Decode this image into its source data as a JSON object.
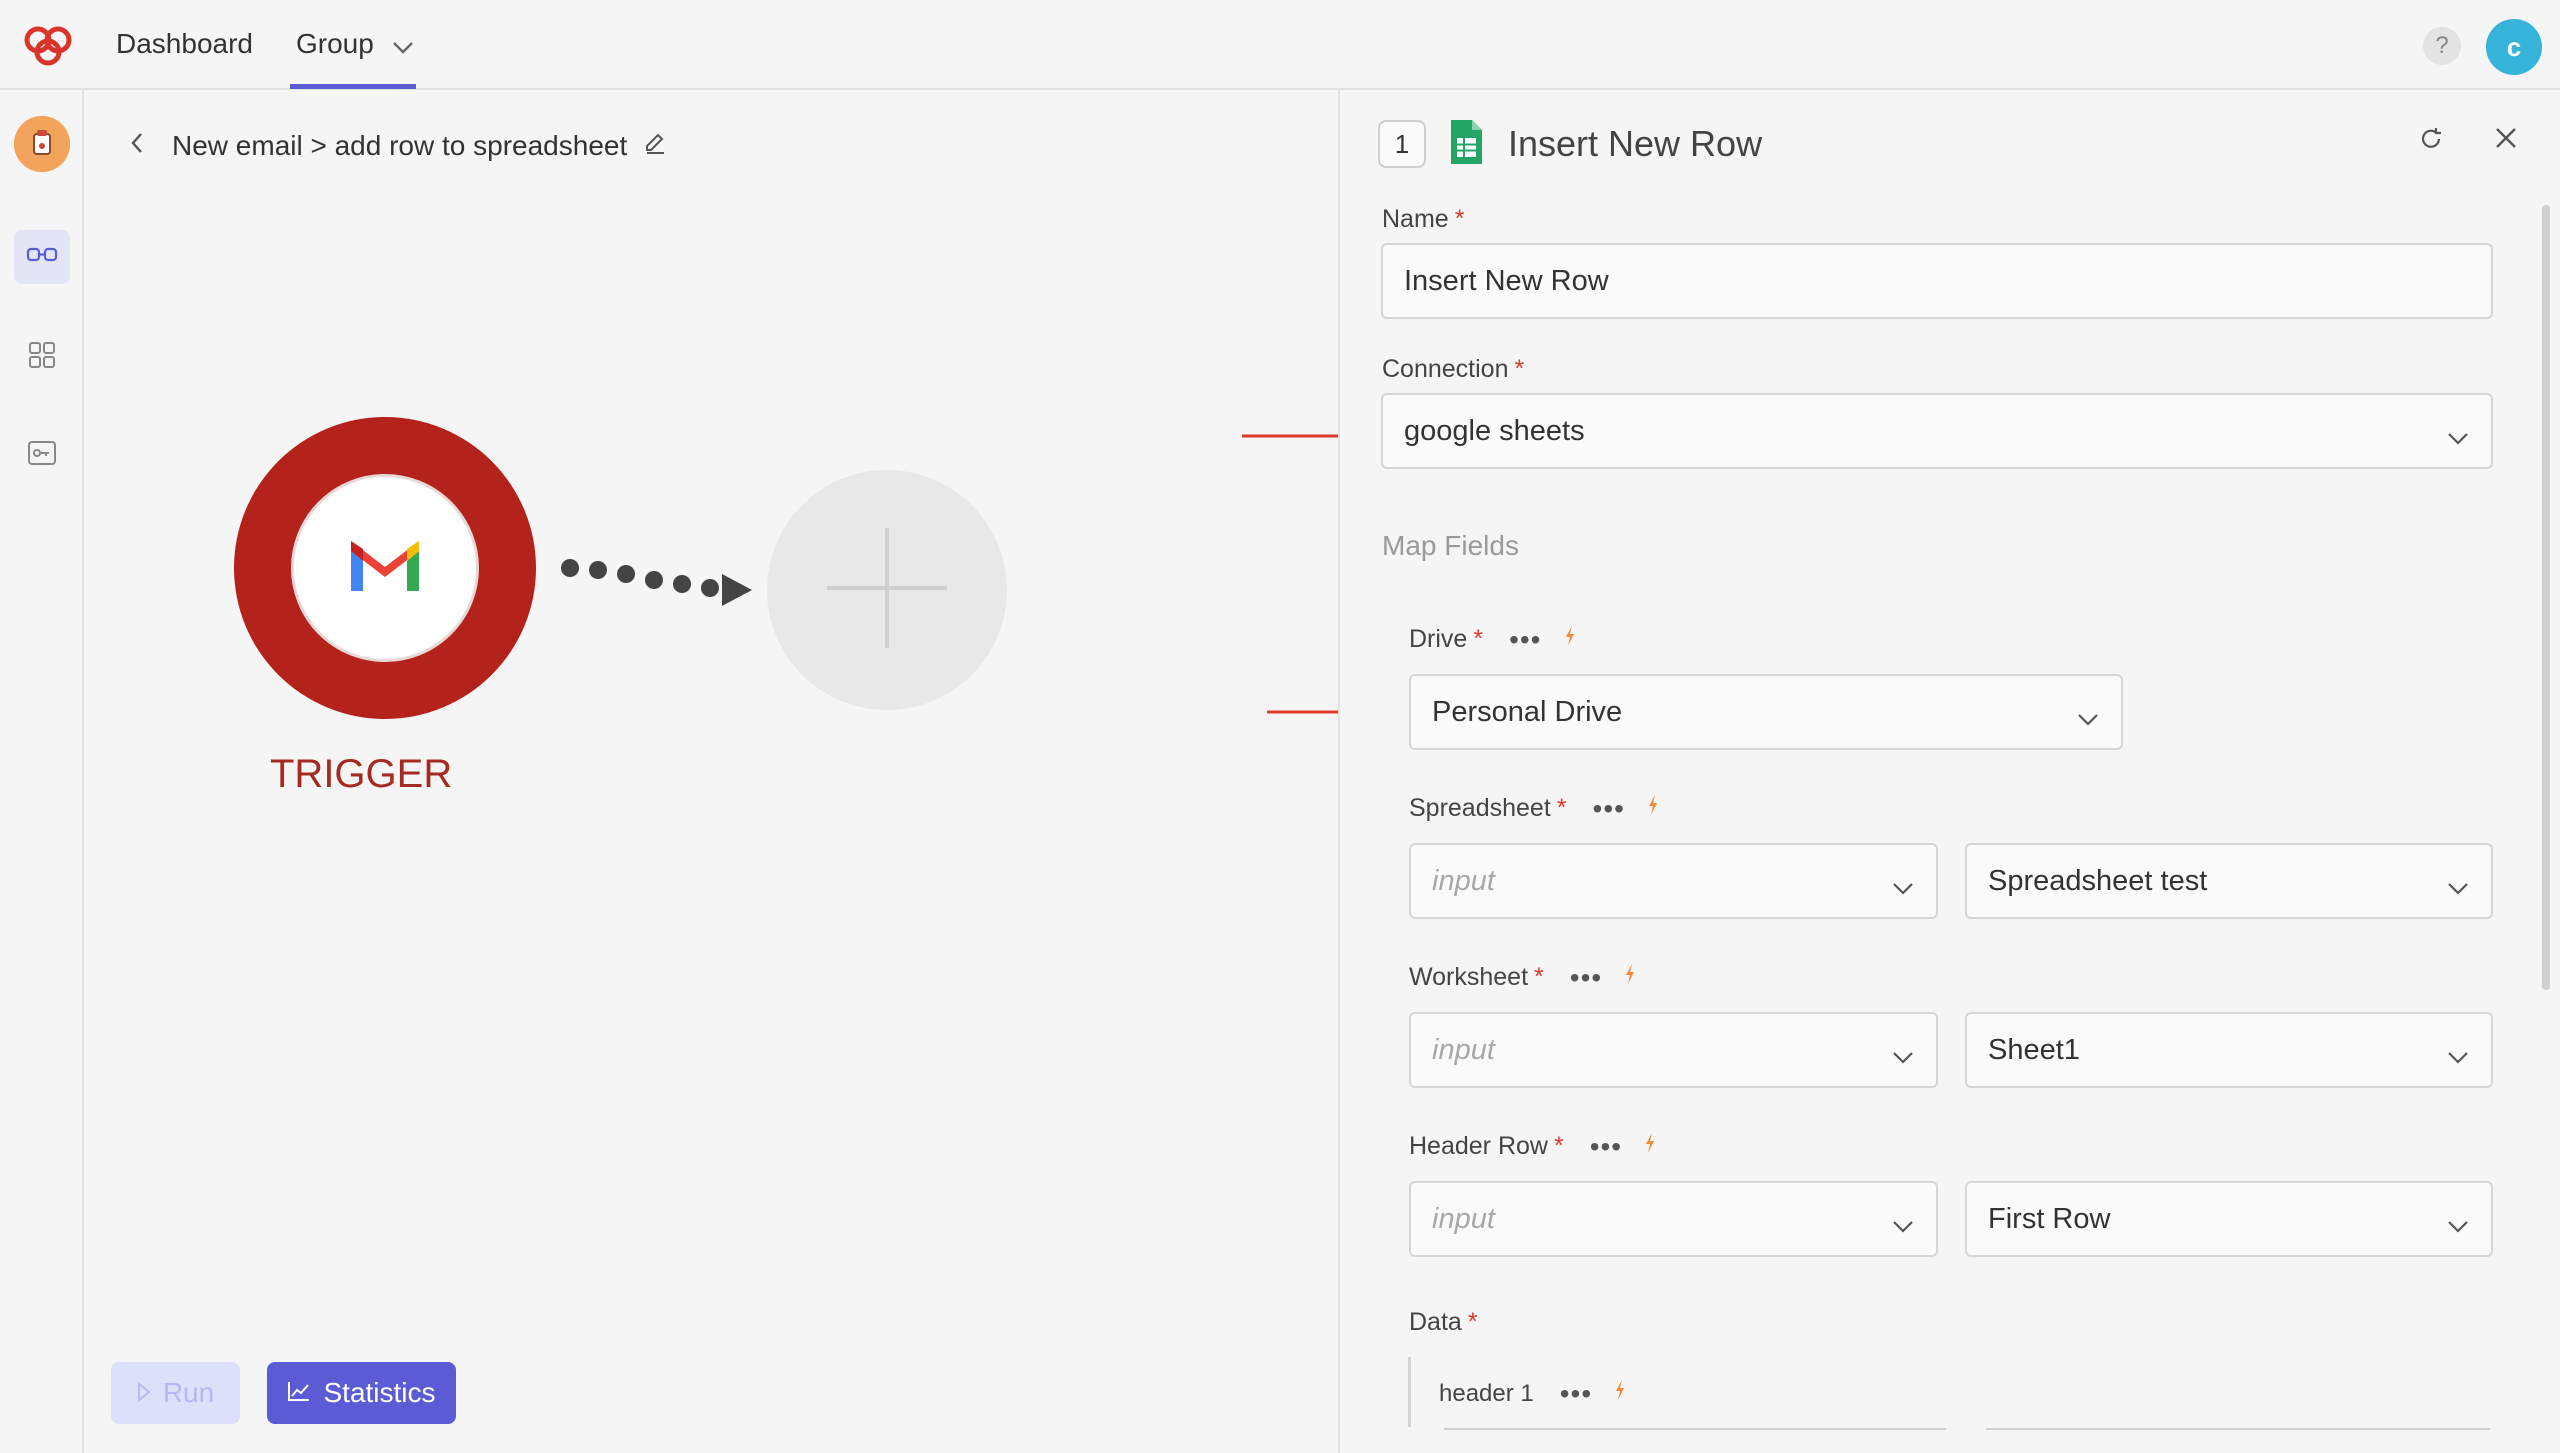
{
  "nav": {
    "dashboard": "Dashboard",
    "group": "Group"
  },
  "user": {
    "avatar_letter": "c",
    "help": "?"
  },
  "breadcrumb": {
    "text": "New email > add row to spreadsheet"
  },
  "flow": {
    "trigger_label": "TRIGGER",
    "run_label": "Run",
    "statistics_label": "Statistics"
  },
  "panel": {
    "step_number": "1",
    "title": "Insert New Row",
    "name_label": "Name",
    "name_value": "Insert New Row",
    "connection_label": "Connection",
    "connection_value": "google sheets",
    "map_fields_label": "Map Fields",
    "drive_label": "Drive",
    "drive_value": "Personal Drive",
    "spreadsheet_label": "Spreadsheet",
    "spreadsheet_input_placeholder": "input",
    "spreadsheet_value": "Spreadsheet test",
    "worksheet_label": "Worksheet",
    "worksheet_input_placeholder": "input",
    "worksheet_value": "Sheet1",
    "header_row_label": "Header Row",
    "header_row_input_placeholder": "input",
    "header_row_value": "First Row",
    "data_label": "Data",
    "header1_label": "header 1",
    "required_mark": "*",
    "more_dots": "•••"
  },
  "colors": {
    "accent": "#5b5bd6",
    "trigger_red": "#b3231b",
    "required": "#e03b2a",
    "annotation_arrow": "#e03b2a",
    "bolt": "#f08a3c"
  }
}
